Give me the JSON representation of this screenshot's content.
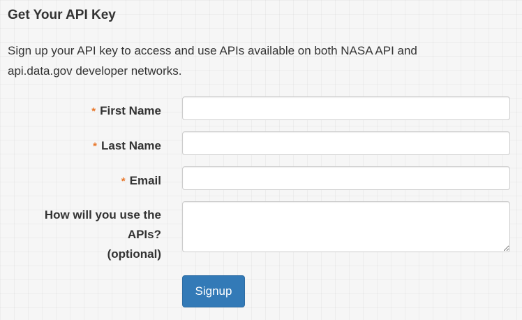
{
  "page": {
    "heading": "Get Your API Key",
    "intro_line1": "Sign up your API key to access and use APIs available on both NASA API and",
    "intro_line2": "api.data.gov developer networks."
  },
  "form": {
    "required_marker": "*",
    "first_name": {
      "label": "First Name",
      "value": "",
      "required": true
    },
    "last_name": {
      "label": "Last Name",
      "value": "",
      "required": true
    },
    "email": {
      "label": "Email",
      "value": "",
      "required": true
    },
    "use": {
      "label_line1": "How will you use the",
      "label_line2": "APIs?",
      "label_line3": "(optional)",
      "value": "",
      "required": false
    },
    "submit_label": "Signup"
  },
  "colors": {
    "required_marker": "#e8772b",
    "button_background": "#337ab7",
    "text": "#333333"
  }
}
